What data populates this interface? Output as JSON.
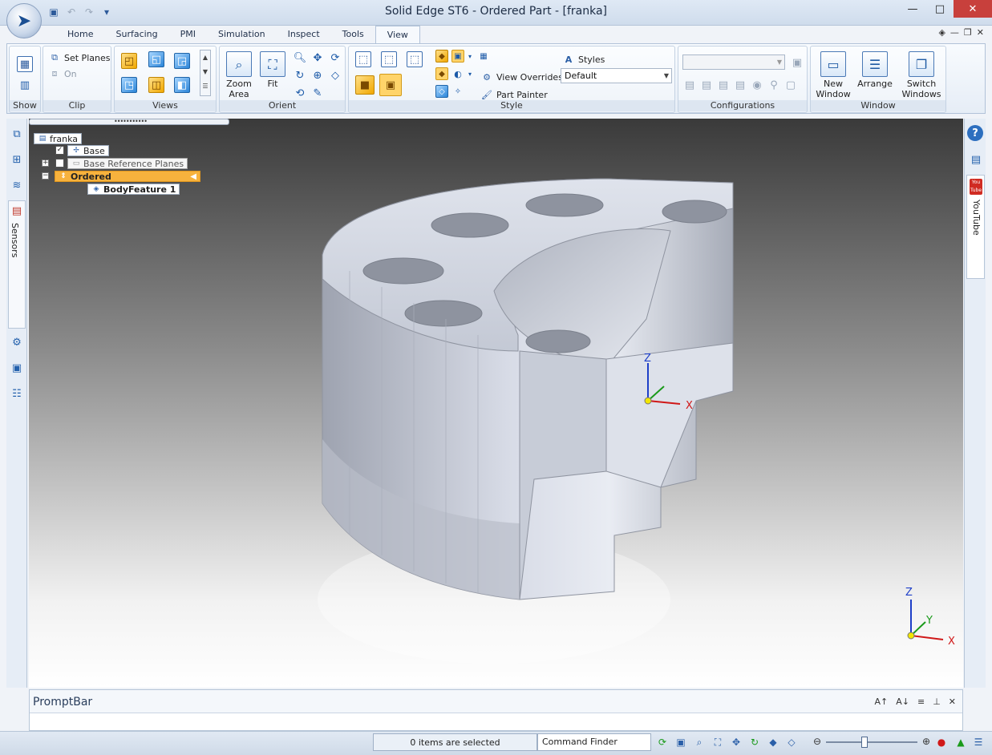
{
  "app": {
    "title": "Solid Edge ST6 - Ordered Part - [franka]"
  },
  "window_controls": {
    "minimize": "—",
    "maximize": "□",
    "close": "✕"
  },
  "ribbon": {
    "tabs": [
      "Home",
      "Surfacing",
      "PMI",
      "Simulation",
      "Inspect",
      "Tools",
      "View"
    ],
    "active_tab": "View",
    "groups": {
      "show": {
        "label": "Show"
      },
      "clip": {
        "label": "Clip",
        "set_planes_label": "Set Planes",
        "on_label": "On"
      },
      "views": {
        "label": "Views"
      },
      "orient": {
        "label": "Orient",
        "zoom_area_label": "Zoom Area",
        "fit_label": "Fit"
      },
      "style": {
        "label": "Style",
        "styles_label": "Styles",
        "style_dropdown_value": "Default",
        "view_overrides_label": "View Overrides",
        "part_painter_label": "Part Painter"
      },
      "configurations": {
        "label": "Configurations",
        "dropdown_value": ""
      },
      "window": {
        "label": "Window",
        "new_window_label": "New Window",
        "arrange_label": "Arrange",
        "switch_windows_label": "Switch Windows"
      }
    }
  },
  "left_bar": {
    "sensors_label": "Sensors"
  },
  "right_bar": {
    "help_glyph": "?",
    "youtube_label": "YouTube",
    "youtube_logo_line1": "You",
    "youtube_logo_line2": "Tube"
  },
  "pathfinder": {
    "root": "franka",
    "items": [
      {
        "label": "Base",
        "checked": true
      },
      {
        "label": "Base Reference Planes",
        "checked": false,
        "expander": "+"
      },
      {
        "label": "Ordered",
        "expander": "−",
        "highlighted": true
      },
      {
        "label": "BodyFeature 1"
      }
    ]
  },
  "triad": {
    "x_label": "X",
    "y_label": "Y",
    "z_label": "Z"
  },
  "promptbar": {
    "title": "PromptBar",
    "tools": [
      "A↑",
      "A↓",
      "≡",
      "⊥",
      "✕"
    ]
  },
  "statusbar": {
    "selection_text": "0 items are selected",
    "command_finder_placeholder": "Command Finder"
  },
  "colors": {
    "highlight": "#f7b23d",
    "accent_blue": "#2d6fbf",
    "close_button": "#c8403c"
  }
}
